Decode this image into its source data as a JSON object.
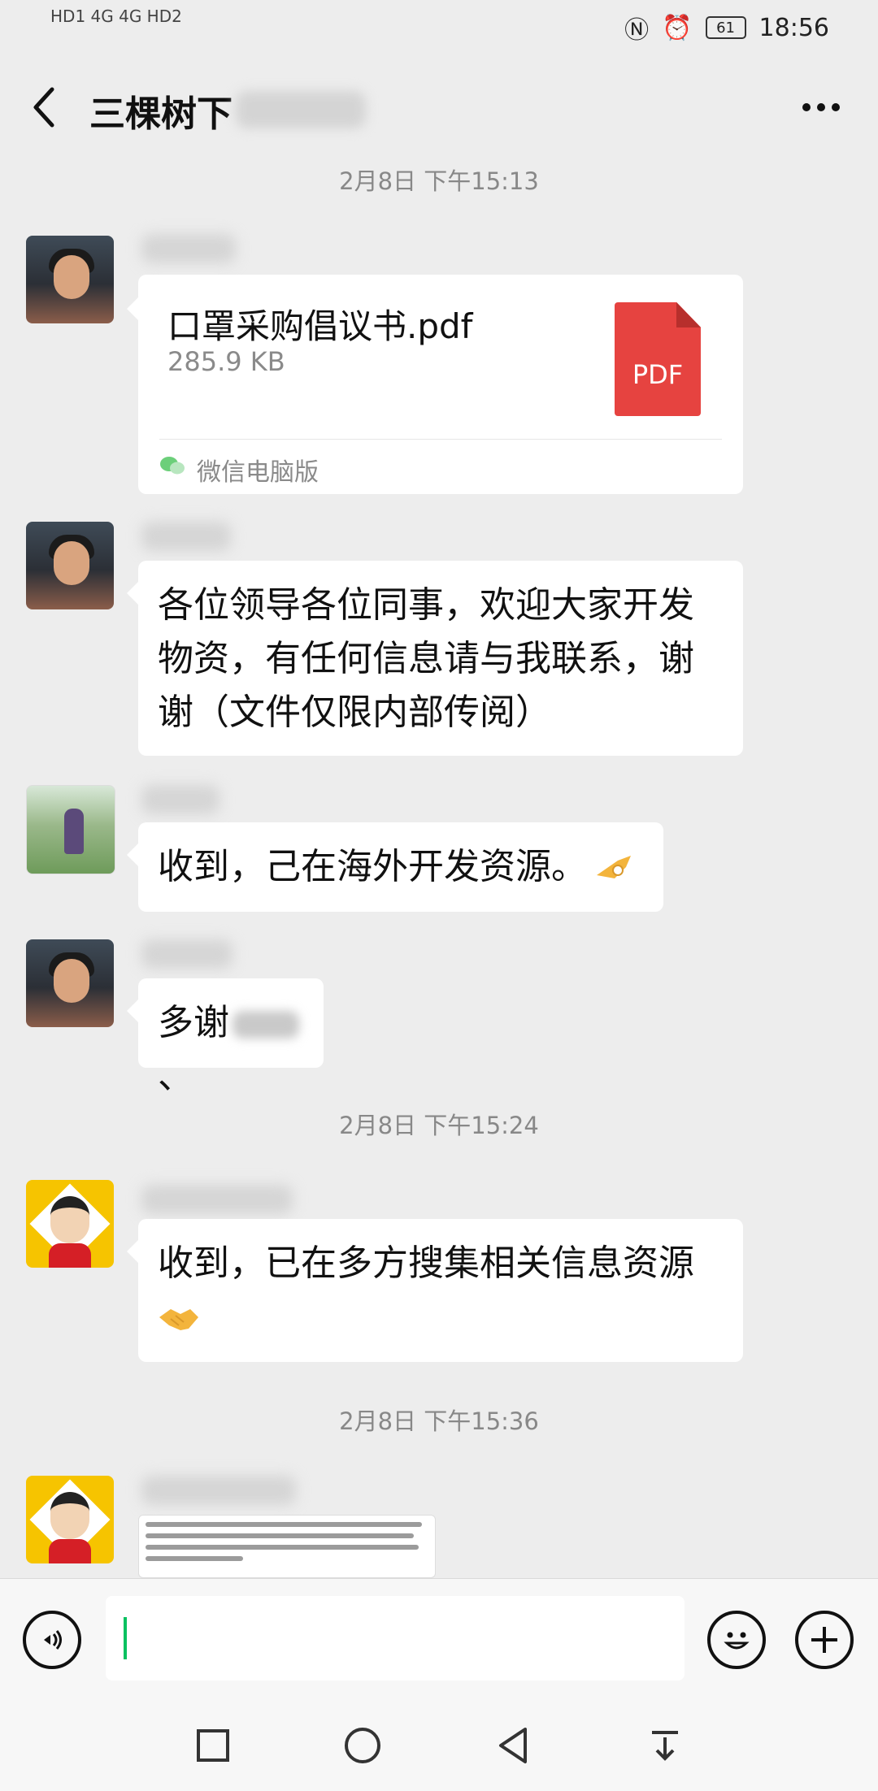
{
  "status_bar": {
    "left_indicators": "HD1 4G 4G HD2",
    "battery": "61",
    "time": "18:56"
  },
  "header": {
    "title": "三棵树下"
  },
  "timestamps": [
    "2月8日 下午15:13",
    "2月8日 下午15:24",
    "2月8日 下午15:36"
  ],
  "messages": {
    "file_card": {
      "file_name": "口罩采购倡议书.pdf",
      "file_size": "285.9 KB",
      "file_icon_label": "PDF",
      "source": "微信电脑版"
    },
    "msg2": "各位领导各位同事，欢迎大家开发物资，有任何信息请与我联系，谢谢（文件仅限内部传阅）",
    "msg3": "收到，己在海外开发资源。",
    "msg4_prefix": "多谢",
    "msg4_suffix": "、",
    "msg5": "收到，已在多方搜集相关信息资源"
  },
  "icons": {
    "back": "chevron-left-icon",
    "more": "more-dots-icon",
    "voice": "voice-icon",
    "emoji": "smile-icon",
    "plus": "plus-icon",
    "nav_square": "square-icon",
    "nav_circle": "circle-icon",
    "nav_back": "triangle-back-icon",
    "nav_down": "down-bar-icon"
  },
  "colors": {
    "accent_green": "#07c160",
    "pdf_red": "#e64340",
    "background": "#ededed"
  }
}
